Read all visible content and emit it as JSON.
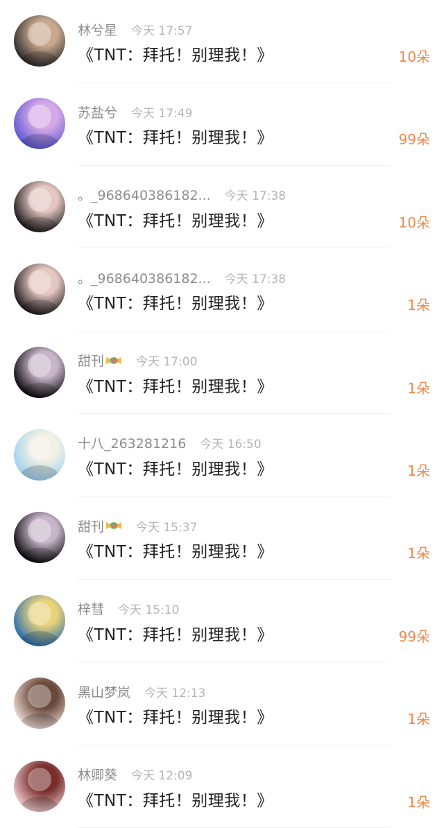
{
  "accent_color": "#f0874a",
  "items": [
    {
      "name": "林兮星",
      "time": "今天 17:57",
      "title": "《TNT：拜托！别理我！》",
      "amount": "10朵",
      "avatar_colors": [
        "#2b2b2b",
        "#c9a88f"
      ],
      "has_candy": false
    },
    {
      "name": "苏盐兮",
      "time": "今天 17:49",
      "title": "《TNT：拜托！别理我！》",
      "amount": "99朵",
      "avatar_colors": [
        "#5e5ad6",
        "#d6a9e6"
      ],
      "has_candy": false
    },
    {
      "name": "。_968640386182...",
      "time": "今天 17:38",
      "title": "《TNT：拜托！别理我！》",
      "amount": "10朵",
      "avatar_colors": [
        "#1e1a1c",
        "#e4c7c2"
      ],
      "has_candy": false
    },
    {
      "name": "。_968640386182...",
      "time": "今天 17:38",
      "title": "《TNT：拜托！别理我！》",
      "amount": "1朵",
      "avatar_colors": [
        "#1e1a1c",
        "#e4c7c2"
      ],
      "has_candy": false
    },
    {
      "name": "甜刊",
      "time": "今天 17:00",
      "title": "《TNT：拜托！别理我！》",
      "amount": "1朵",
      "avatar_colors": [
        "#0d0b0f",
        "#c8b5c9"
      ],
      "has_candy": true
    },
    {
      "name": "十八_263281216",
      "time": "今天 16:50",
      "title": "《TNT：拜托！别理我！》",
      "amount": "1朵",
      "avatar_colors": [
        "#9fd3ef",
        "#f3f0e4"
      ],
      "has_candy": false
    },
    {
      "name": "甜刊",
      "time": "今天 15:37",
      "title": "《TNT：拜托！别理我！》",
      "amount": "1朵",
      "avatar_colors": [
        "#0d0b0f",
        "#c8b5c9"
      ],
      "has_candy": true
    },
    {
      "name": "梓彗",
      "time": "今天 15:10",
      "title": "《TNT：拜托！别理我！》",
      "amount": "99朵",
      "avatar_colors": [
        "#2a6fb0",
        "#e8d27a"
      ],
      "has_candy": false
    },
    {
      "name": "黑山梦岚",
      "time": "今天 12:13",
      "title": "《TNT：拜托！别理我！》",
      "amount": "1朵",
      "avatar_colors": [
        "#e9d7cf",
        "#6b4a3d"
      ],
      "has_candy": false
    },
    {
      "name": "林卿葵",
      "time": "今天 12:09",
      "title": "《TNT：拜托！别理我！》",
      "amount": "1朵",
      "avatar_colors": [
        "#e9c6c9",
        "#7a2e2c"
      ],
      "has_candy": false
    }
  ]
}
